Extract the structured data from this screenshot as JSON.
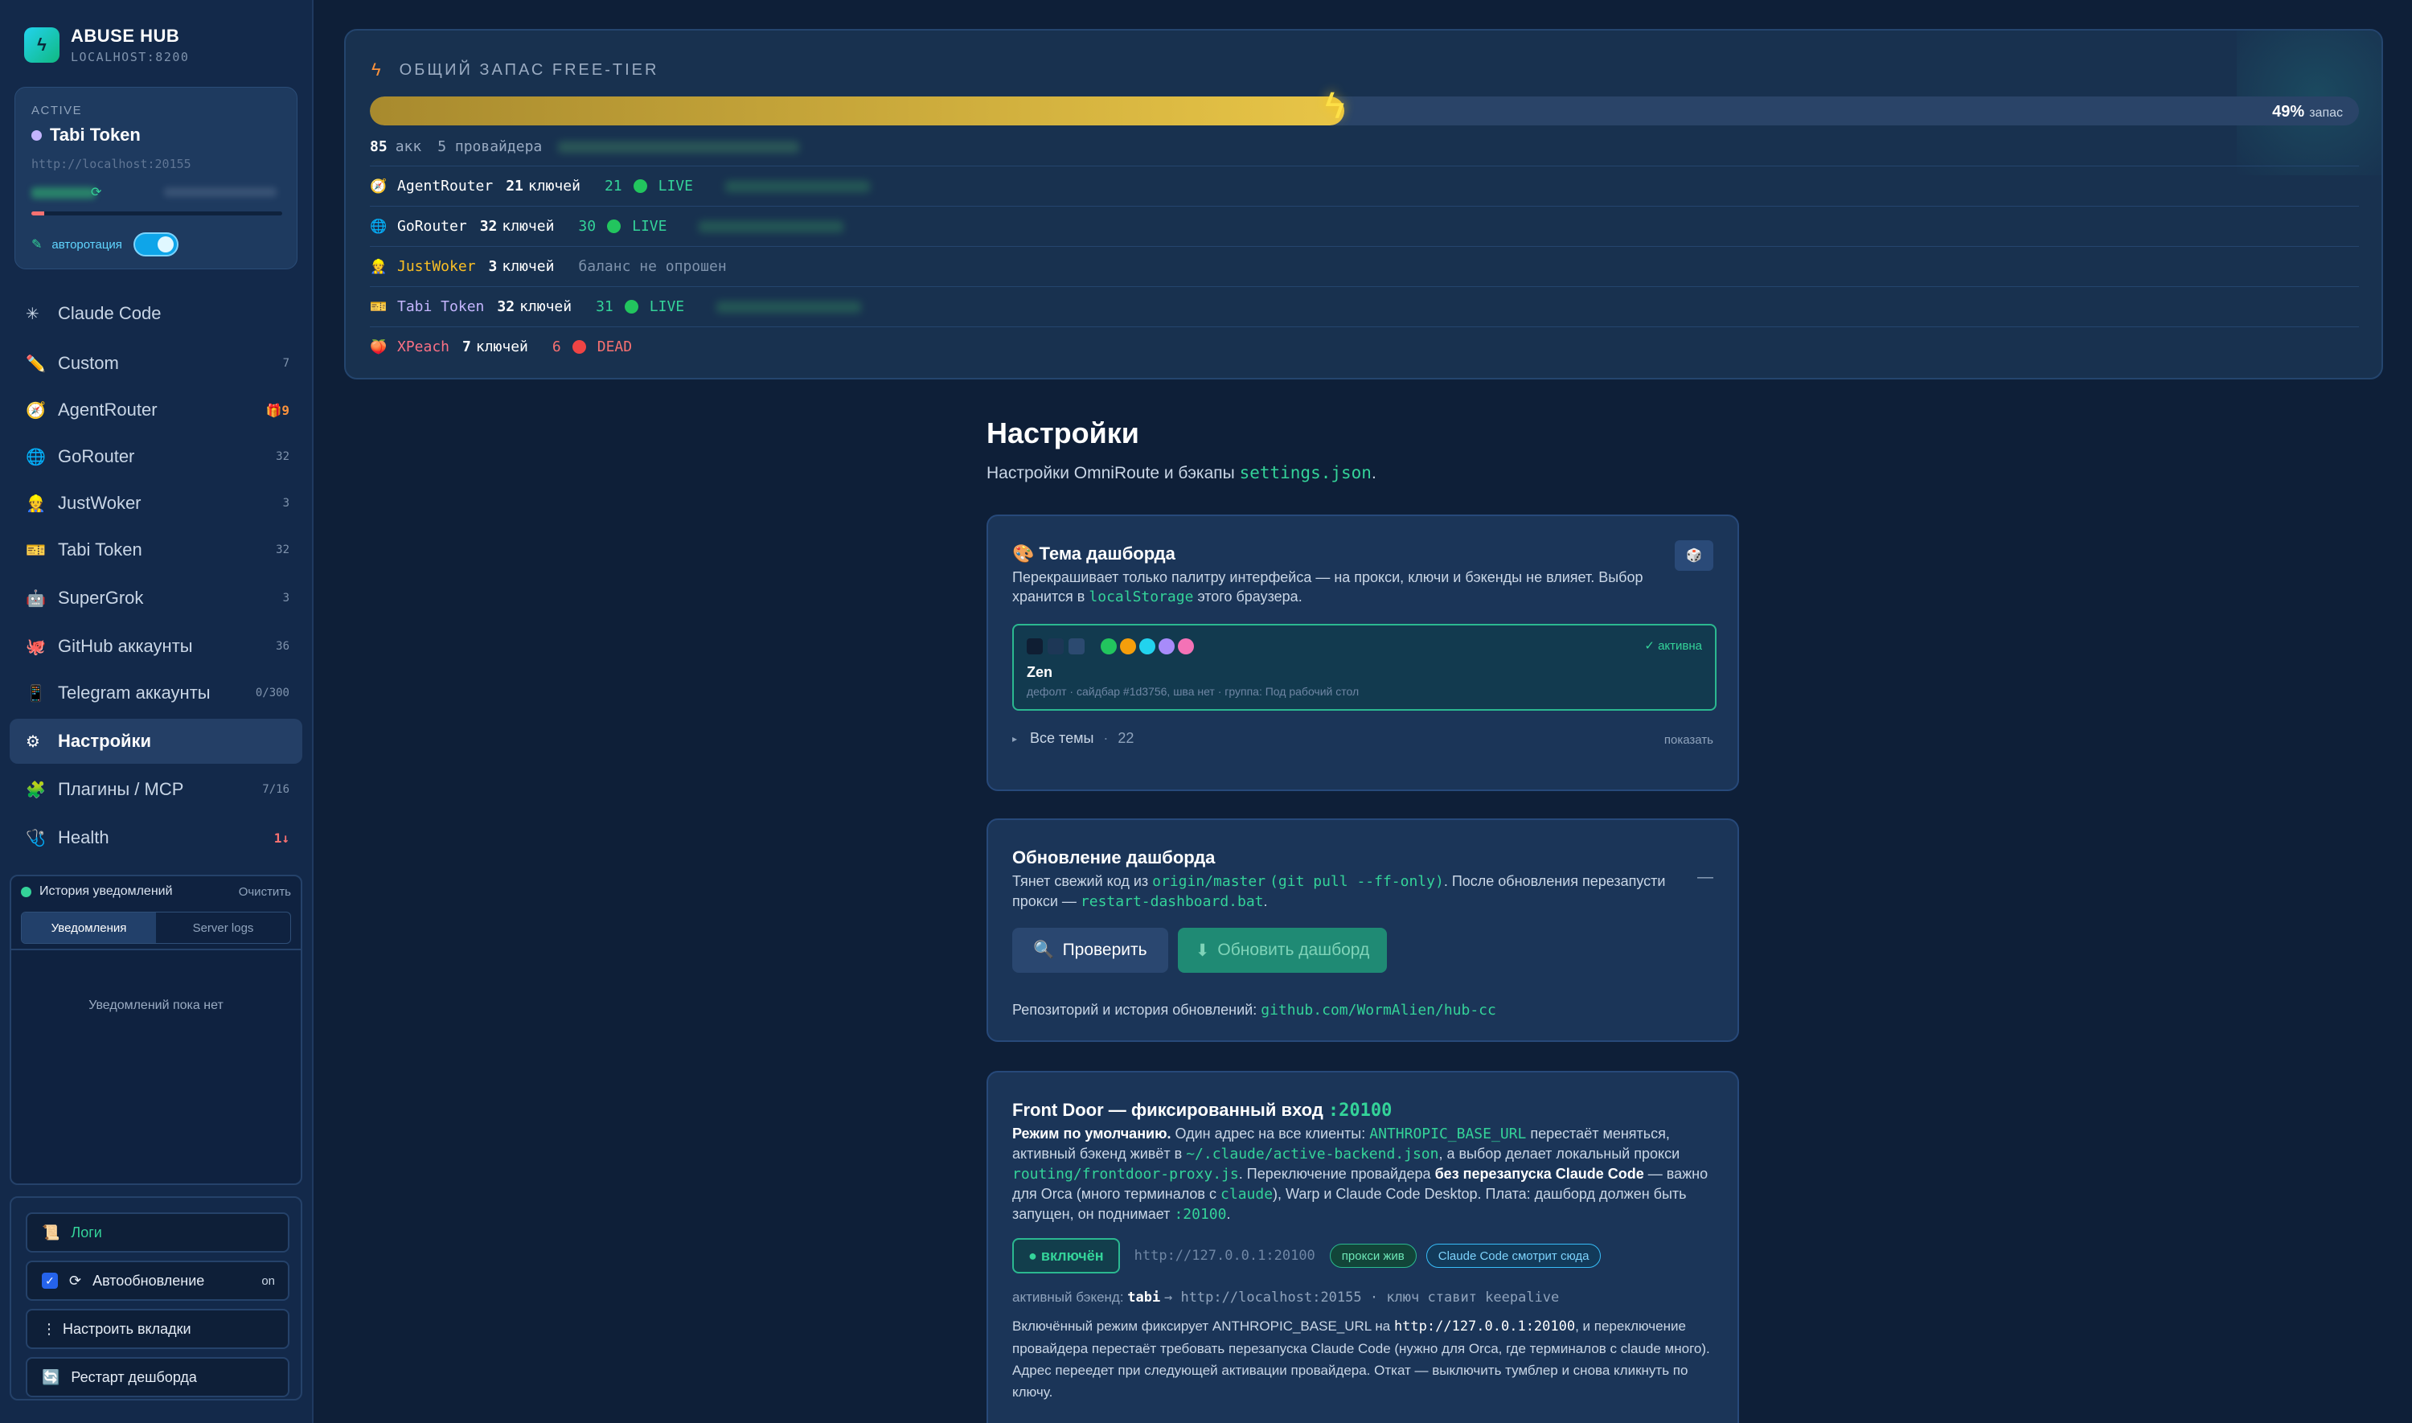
{
  "sidebar": {
    "brand": {
      "title": "ABUSE HUB",
      "subtitle": "LOCALHOST:8200"
    },
    "active_card": {
      "label": "ACTIVE",
      "name": "Tabi Token",
      "url": "http://localhost:20155",
      "autorotation_label": "авторотация",
      "autorotation_on": true,
      "usage_fraction": 0.05
    },
    "nav": [
      {
        "label": "Claude Code",
        "icon": "asterisk-icon",
        "badge": ""
      },
      {
        "label": "Custom",
        "icon": "pencil-icon",
        "badge": "7"
      },
      {
        "label": "AgentRouter",
        "icon": "compass-icon",
        "badge": "🎁9"
      },
      {
        "label": "GoRouter",
        "icon": "globe-icon",
        "badge": "32"
      },
      {
        "label": "JustWoker",
        "icon": "worker-icon",
        "badge": "3"
      },
      {
        "label": "Tabi Token",
        "icon": "ticket-icon",
        "badge": "32"
      },
      {
        "label": "SuperGrok",
        "icon": "robot-icon",
        "badge": "3"
      },
      {
        "label": "GitHub аккаунты",
        "icon": "octocat-icon",
        "badge": "36"
      },
      {
        "label": "Telegram аккаунты",
        "icon": "phone-icon",
        "badge": "0/300"
      },
      {
        "label": "Настройки",
        "icon": "gear-icon",
        "badge": ""
      },
      {
        "label": "Плагины / MCP",
        "icon": "puzzle-icon",
        "badge": "7/16"
      },
      {
        "label": "Health",
        "icon": "stethoscope-icon",
        "badge": "1↓"
      }
    ],
    "notifications": {
      "title": "История уведомлений",
      "clear": "Очистить",
      "tab_notifications": "Уведомления",
      "tab_logs": "Server logs",
      "empty": "Уведомлений пока нет"
    },
    "actions": {
      "logs": "Логи",
      "autoupdate": "Автообновление",
      "autoupdate_state": "on",
      "tabs": "Настроить вкладки",
      "restart": "Рестарт дешборда"
    }
  },
  "quota": {
    "title": "ОБЩИЙ ЗАПАС FREE-TIER",
    "percent": "49%",
    "percent_label": "запас",
    "fill_fraction": 0.49,
    "summary_count": "85",
    "summary_unit": "акк",
    "summary_providers": "5 провайдера",
    "providers": [
      {
        "icon": "compass-icon",
        "name": "AgentRouter",
        "keys": "21",
        "keys_unit": "ключей",
        "live": "21",
        "status": "LIVE",
        "color": "#ffffff",
        "status_color": "#34d399",
        "dot": "#22c55e",
        "note": ""
      },
      {
        "icon": "globe-icon",
        "name": "GoRouter",
        "keys": "32",
        "keys_unit": "ключей",
        "live": "30",
        "status": "LIVE",
        "color": "#ffffff",
        "status_color": "#34d399",
        "dot": "#22c55e",
        "note": ""
      },
      {
        "icon": "worker-icon",
        "name": "JustWoker",
        "keys": "3",
        "keys_unit": "ключей",
        "live": "",
        "status": "",
        "color": "#fbbf24",
        "status_color": "#34d399",
        "dot": "",
        "note": "баланс не опрошен"
      },
      {
        "icon": "ticket-icon",
        "name": "Tabi Token",
        "keys": "32",
        "keys_unit": "ключей",
        "live": "31",
        "status": "LIVE",
        "color": "#c4b5fd",
        "status_color": "#34d399",
        "dot": "#22c55e",
        "note": ""
      },
      {
        "icon": "peach-icon",
        "name": "XPeach",
        "keys": "7",
        "keys_unit": "ключей",
        "live": "6",
        "status": "DEAD",
        "color": "#fb7185",
        "status_color": "#f87171",
        "dot": "#ef4444",
        "note": ""
      }
    ]
  },
  "settings": {
    "title": "Настройки",
    "subtitle_prefix": "Настройки OmniRoute и бэкапы",
    "subtitle_code": "settings.json",
    "subtitle_suffix": ".",
    "theme_card": {
      "title": "Тема дашборда",
      "desc_1": "Перекрашивает только палитру интерфейса — на прокси, ключи и бэкенды не влияет. Выбор хранится в",
      "desc_code": "localStorage",
      "desc_2": "этого браузера.",
      "active_label": "✓ активна",
      "theme_name": "Zen",
      "theme_meta": "дефолт · сайдбар #1d3756, шва нет · группа: Под рабочий стол",
      "swatches": [
        "#0f1e33",
        "#1d3756",
        "#2c4a70"
      ],
      "dots": [
        "#22c55e",
        "#f59e0b",
        "#22d3ee",
        "#a78bfa",
        "#f472b6"
      ],
      "all_themes": "Все темы",
      "all_count": "22",
      "show": "показать"
    },
    "update_card": {
      "title": "Обновление дашборда",
      "desc_1": "Тянет свежий код из",
      "code_1": "origin/master",
      "code_2": "(git pull --ff-only)",
      "desc_2": ". После обновления перезапусти прокси —",
      "code_3": "restart-dashboard.bat",
      "desc_3": ".",
      "check_btn": "Проверить",
      "update_btn": "Обновить дашборд",
      "repo_label": "Репозиторий и история обновлений:",
      "repo_link": "github.com/WormAlien/hub-cc"
    },
    "frontdoor_card": {
      "title": "Front Door — фиксированный вход",
      "title_port": ":20100",
      "mode_bold": "Режим по умолчанию.",
      "p1": "Один адрес на все клиенты:",
      "c1": "ANTHROPIC_BASE_URL",
      "p2": "перестаёт меняться, активный бэкенд живёт в",
      "c2": "~/.claude/active-backend.json",
      "p3": ", а выбор делает локальный прокси",
      "c3": "routing/frontdoor-proxy.js",
      "p4": ". Переключение провайдера",
      "b2": "без перезапуска Claude Code",
      "p5": "— важно для Orca (много терминалов с",
      "c4": "claude",
      "p6": "), Warp и Claude Code Desktop. Плата: дашборд должен быть запущен, он поднимает",
      "c5": ":20100",
      "p7": ".",
      "status_on": "● включён",
      "url": "http://127.0.0.1:20100",
      "pill_proxy": "прокси жив",
      "pill_claude": "Claude Code смотрит сюда",
      "backend_label": "активный бэкенд:",
      "backend_name": "tabi",
      "backend_rest": "→ http://localhost:20155 · ключ ставит keepalive",
      "note_1": "Включённый режим фиксирует ANTHROPIC_BASE_URL на",
      "note_code": "http://127.0.0.1:20100",
      "note_2": ", и переключение провайдера перестаёт требовать перезапуска Claude Code (нужно для Orca, где терминалов с claude много). Адрес переедет при следующей активации провайдера. Откат — выключить тумблер и снова кликнуть по ключу."
    }
  }
}
